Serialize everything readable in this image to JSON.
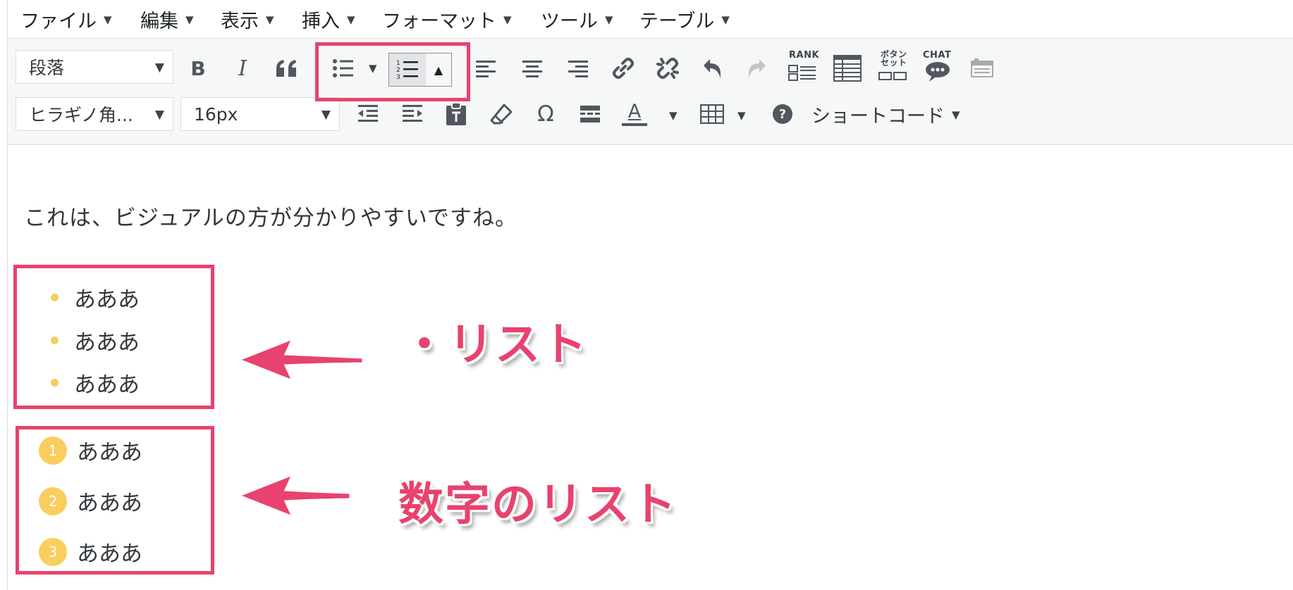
{
  "menubar": {
    "items": [
      {
        "label": "ファイル"
      },
      {
        "label": "編集"
      },
      {
        "label": "表示"
      },
      {
        "label": "挿入"
      },
      {
        "label": "フォーマット"
      },
      {
        "label": "ツール"
      },
      {
        "label": "テーブル"
      }
    ]
  },
  "toolbar": {
    "block_format": "段落",
    "font_family": "ヒラギノ角...",
    "font_size": "16px",
    "rank_label": "RANK",
    "button_set_label_1": "ボタン",
    "button_set_label_2": "セット",
    "chat_label": "CHAT",
    "text_color_letter": "A",
    "shortcode_label": "ショートコード",
    "omega": "Ω",
    "bold": "B",
    "italic": "I"
  },
  "content": {
    "paragraph": "これは、ビジュアルの方が分かりやすいですね。",
    "bullet_items": [
      "あああ",
      "あああ",
      "あああ"
    ],
    "numbered_items": [
      {
        "num": "1",
        "text": "あああ"
      },
      {
        "num": "2",
        "text": "あああ"
      },
      {
        "num": "3",
        "text": "あああ"
      }
    ]
  },
  "annotations": {
    "bullet_label": "・リスト",
    "numbered_label": "数字のリスト"
  },
  "colors": {
    "highlight": "#e8426e",
    "bullet": "#f7cc5c",
    "badge": "#f9cd5e"
  }
}
